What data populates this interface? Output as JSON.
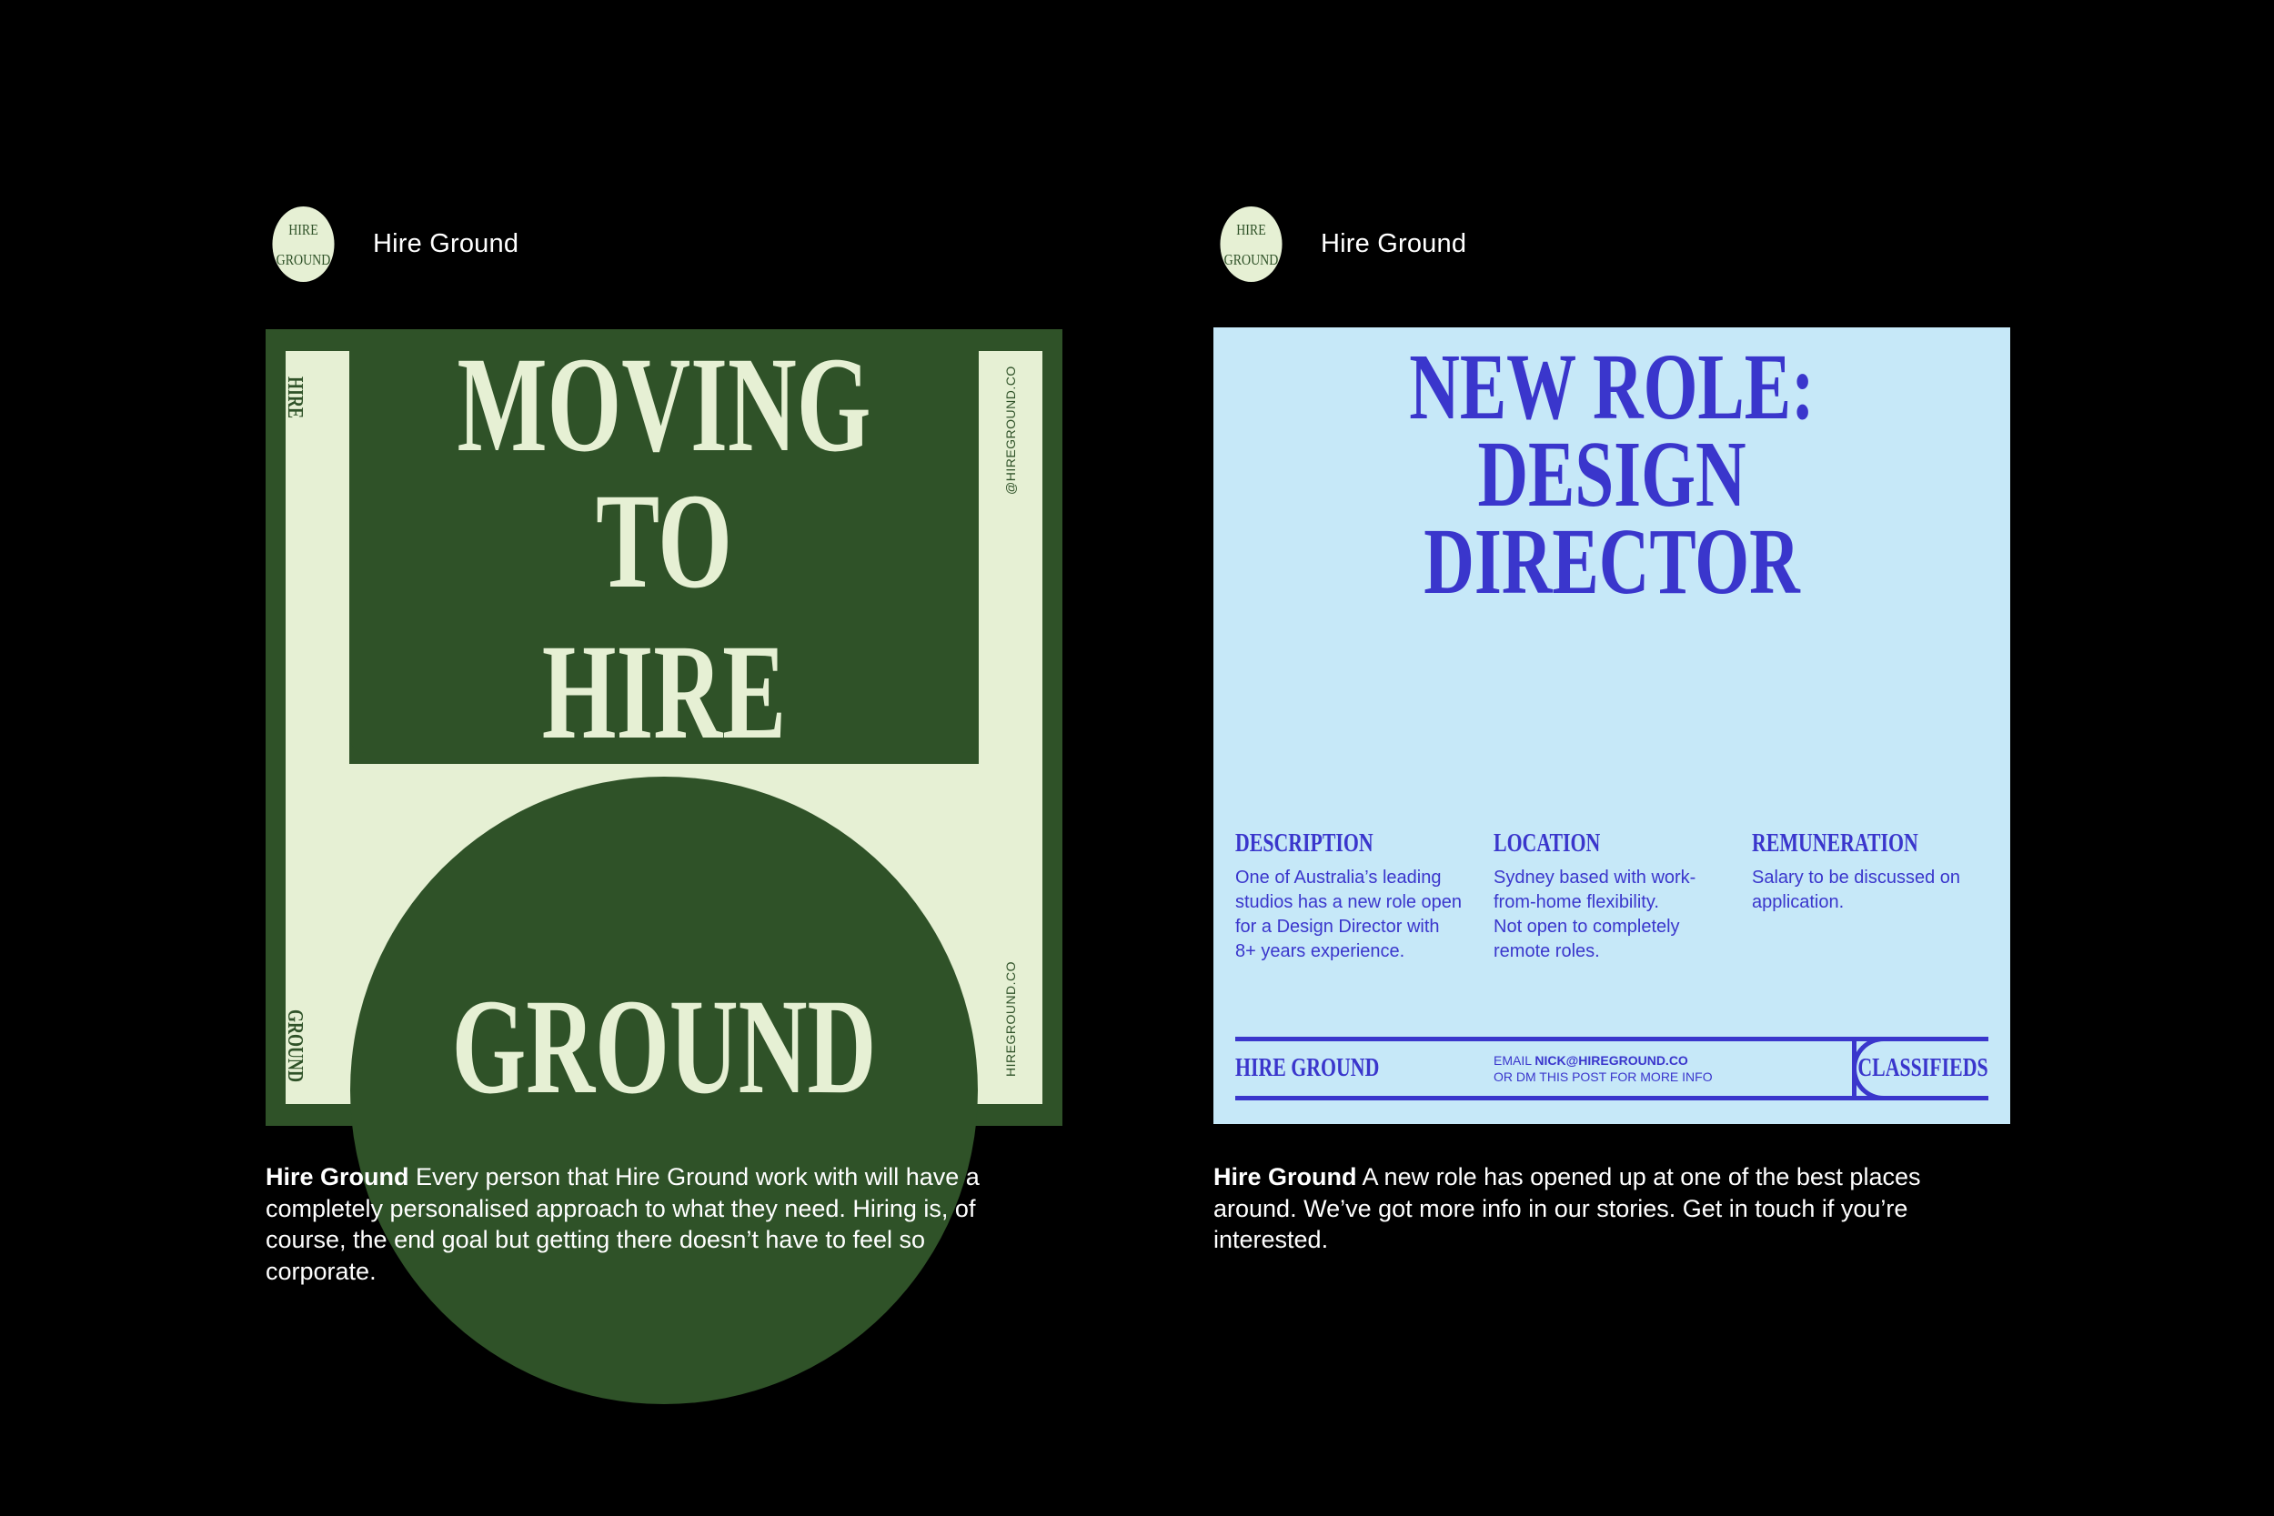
{
  "posts": [
    {
      "username": "Hire Ground",
      "avatar_lines": [
        "HIRE",
        "GROUND"
      ],
      "image": {
        "headline_top": "MOVING TO",
        "headline_mid": "HIRE",
        "headline_bottom": "GROUND",
        "side_left_top": "HIRE",
        "side_left_bottom": "GROUND",
        "side_right_top": "@HIREGROUND.CO",
        "side_right_bottom": "HIREGROUND.CO"
      },
      "caption_name": "Hire Ground",
      "caption_text": " Every person that Hire Ground work with will have a completely personalised approach to what they need. Hiring is, of course, the end goal but getting there doesn’t have to feel so corporate."
    },
    {
      "username": "Hire Ground",
      "avatar_lines": [
        "HIRE",
        "GROUND"
      ],
      "image": {
        "title_line1": "NEW ROLE:",
        "title_line2": "DESIGN DIRECTOR",
        "columns": [
          {
            "heading": "DESCRIPTION",
            "text": "One of Australia’s leading\nstudios has a new role open\nfor a Design Director with\n8+ years experience."
          },
          {
            "heading": "LOCATION",
            "text": "Sydney based with work-\nfrom-home flexibility.\nNot open to completely\nremote roles."
          },
          {
            "heading": "REMUNERATION",
            "text": "Salary to be discussed on\napplication."
          }
        ],
        "footer_brand": "HIRE  GROUND",
        "footer_email_label": "EMAIL ",
        "footer_email": "NICK@HIREGROUND.CO",
        "footer_dm": "OR DM THIS POST FOR MORE INFO",
        "footer_tag": "CLASSIFIEDS"
      },
      "caption_name": "Hire Ground",
      "caption_text": " A new role has opened up at one of the best places around. We’ve got more info in our stories. Get in touch if you’re interested."
    }
  ]
}
